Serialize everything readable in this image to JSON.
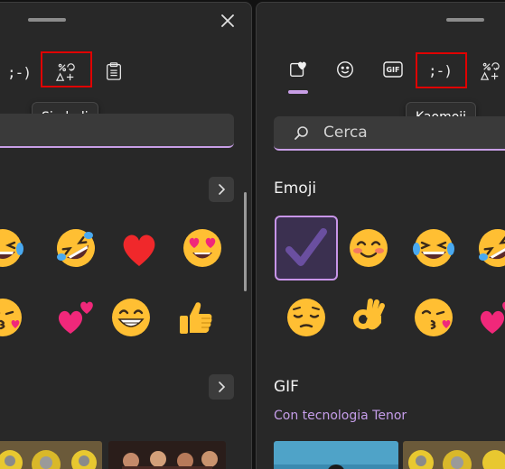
{
  "left_panel": {
    "tabs": {
      "kaomoji": ";-)"
    },
    "tooltip": "Simboli",
    "colors": {
      "highlight": "#e00000",
      "accent": "#c89ee6"
    },
    "emoji_rows": [
      [
        "grinning-squinting-face",
        "rolling-on-floor-laughing",
        "red-heart",
        "smiling-face-with-heart-eyes"
      ],
      [
        "face-blowing-kiss",
        "two-hearts",
        "beaming-face",
        "thumbs-up"
      ]
    ]
  },
  "right_panel": {
    "tabs": {
      "gif": "GIF",
      "kaomoji": ";-)"
    },
    "tooltip": "Kaomoji",
    "search": {
      "placeholder": "Cerca"
    },
    "emoji_section": {
      "title": "Emoji"
    },
    "emoji_rows": [
      [
        "check-mark",
        "smiling-face",
        "grinning-squinting-face",
        "rolling-on-floor-laughing"
      ],
      [
        "pensive-face",
        "ok-hand",
        "face-blowing-kiss",
        "two-hearts"
      ]
    ],
    "gif_section": {
      "title": "GIF",
      "powered_by": "Con tecnologia Tenor"
    }
  }
}
